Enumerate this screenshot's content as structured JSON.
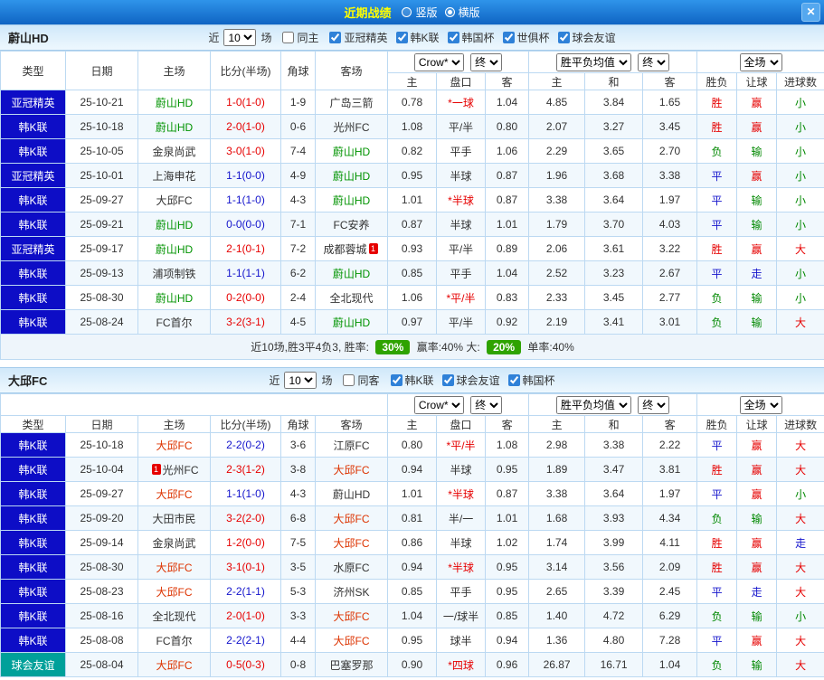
{
  "titlebar": {
    "title": "近期战绩",
    "radio_vertical": "竖版",
    "radio_horizontal": "横版",
    "selected": "横版",
    "close_icon": "✕"
  },
  "controls": {
    "recent_label": "近",
    "recent_value": "10",
    "matches_label": "场"
  },
  "odds_header": {
    "company_select": "Crow*",
    "final_label": "终",
    "europe_select": "胜平负均值",
    "fulltime_select": "全场",
    "ah_cols": [
      "主",
      "盘口",
      "客"
    ],
    "eu_cols": [
      "主",
      "和",
      "客"
    ],
    "result_cols": [
      "胜负",
      "让球",
      "进球数"
    ]
  },
  "table_header": [
    "类型",
    "日期",
    "主场",
    "比分(半场)",
    "角球",
    "客场"
  ],
  "colors": {
    "league_badge": "#0d0dc6",
    "friendly_badge": "#00a09a",
    "win": "#e60000",
    "draw": "#1414cc",
    "loss": "#008800",
    "team_home": "#009300",
    "team_away": "#dd3300",
    "rate_badge": "#2fa300"
  },
  "sections": [
    {
      "team": "蔚山HD",
      "same_venue_label": "同主",
      "same_venue_checked": false,
      "league_filters": [
        {
          "label": "亚冠精英",
          "checked": true
        },
        {
          "label": "韩K联",
          "checked": true
        },
        {
          "label": "韩国杯",
          "checked": true
        },
        {
          "label": "世俱杯",
          "checked": true
        },
        {
          "label": "球会友谊",
          "checked": true
        }
      ],
      "rows": [
        {
          "type": "亚冠精英",
          "tc": "league",
          "date": "25-10-21",
          "home": "蔚山HD",
          "home_c": "green",
          "home_card": "",
          "score": "1-0(1-0)",
          "score_c": "red",
          "corners": "1-9",
          "away": "广岛三箭",
          "away_c": "",
          "away_card": "",
          "ah": [
            "0.78",
            "*一球",
            "1.04"
          ],
          "ah_red": true,
          "eu": [
            "4.85",
            "3.84",
            "1.65"
          ],
          "res": [
            "胜",
            "赢",
            "小"
          ],
          "res_c": [
            "red",
            "red",
            "green"
          ]
        },
        {
          "type": "韩K联",
          "tc": "league",
          "date": "25-10-18",
          "home": "蔚山HD",
          "home_c": "green",
          "home_card": "",
          "score": "2-0(1-0)",
          "score_c": "red",
          "corners": "0-6",
          "away": "光州FC",
          "away_c": "",
          "away_card": "",
          "ah": [
            "1.08",
            "平/半",
            "0.80"
          ],
          "ah_red": false,
          "eu": [
            "2.07",
            "3.27",
            "3.45"
          ],
          "res": [
            "胜",
            "赢",
            "小"
          ],
          "res_c": [
            "red",
            "red",
            "green"
          ]
        },
        {
          "type": "韩K联",
          "tc": "league",
          "date": "25-10-05",
          "home": "金泉尚武",
          "home_c": "",
          "home_card": "",
          "score": "3-0(1-0)",
          "score_c": "red",
          "corners": "7-4",
          "away": "蔚山HD",
          "away_c": "green",
          "away_card": "",
          "ah": [
            "0.82",
            "平手",
            "1.06"
          ],
          "ah_red": false,
          "eu": [
            "2.29",
            "3.65",
            "2.70"
          ],
          "res": [
            "负",
            "输",
            "小"
          ],
          "res_c": [
            "green",
            "green",
            "green"
          ]
        },
        {
          "type": "亚冠精英",
          "tc": "league",
          "date": "25-10-01",
          "home": "上海申花",
          "home_c": "",
          "home_card": "",
          "score": "1-1(0-0)",
          "score_c": "blue",
          "corners": "4-9",
          "away": "蔚山HD",
          "away_c": "green",
          "away_card": "",
          "ah": [
            "0.95",
            "半球",
            "0.87"
          ],
          "ah_red": false,
          "eu": [
            "1.96",
            "3.68",
            "3.38"
          ],
          "res": [
            "平",
            "赢",
            "小"
          ],
          "res_c": [
            "blue",
            "red",
            "green"
          ]
        },
        {
          "type": "韩K联",
          "tc": "league",
          "date": "25-09-27",
          "home": "大邱FC",
          "home_c": "",
          "home_card": "",
          "score": "1-1(1-0)",
          "score_c": "blue",
          "corners": "4-3",
          "away": "蔚山HD",
          "away_c": "green",
          "away_card": "",
          "ah": [
            "1.01",
            "*半球",
            "0.87"
          ],
          "ah_red": true,
          "eu": [
            "3.38",
            "3.64",
            "1.97"
          ],
          "res": [
            "平",
            "输",
            "小"
          ],
          "res_c": [
            "blue",
            "green",
            "green"
          ]
        },
        {
          "type": "韩K联",
          "tc": "league",
          "date": "25-09-21",
          "home": "蔚山HD",
          "home_c": "green",
          "home_card": "",
          "score": "0-0(0-0)",
          "score_c": "blue",
          "corners": "7-1",
          "away": "FC安养",
          "away_c": "",
          "away_card": "",
          "ah": [
            "0.87",
            "半球",
            "1.01"
          ],
          "ah_red": false,
          "eu": [
            "1.79",
            "3.70",
            "4.03"
          ],
          "res": [
            "平",
            "输",
            "小"
          ],
          "res_c": [
            "blue",
            "green",
            "green"
          ]
        },
        {
          "type": "亚冠精英",
          "tc": "league",
          "date": "25-09-17",
          "home": "蔚山HD",
          "home_c": "green",
          "home_card": "",
          "score": "2-1(0-1)",
          "score_c": "red",
          "corners": "7-2",
          "away": "成都蓉城",
          "away_c": "",
          "away_card": "1",
          "ah": [
            "0.93",
            "平/半",
            "0.89"
          ],
          "ah_red": false,
          "eu": [
            "2.06",
            "3.61",
            "3.22"
          ],
          "res": [
            "胜",
            "赢",
            "大"
          ],
          "res_c": [
            "red",
            "red",
            "red"
          ]
        },
        {
          "type": "韩K联",
          "tc": "league",
          "date": "25-09-13",
          "home": "浦项制铁",
          "home_c": "",
          "home_card": "",
          "score": "1-1(1-1)",
          "score_c": "blue",
          "corners": "6-2",
          "away": "蔚山HD",
          "away_c": "green",
          "away_card": "",
          "ah": [
            "0.85",
            "平手",
            "1.04"
          ],
          "ah_red": false,
          "eu": [
            "2.52",
            "3.23",
            "2.67"
          ],
          "res": [
            "平",
            "走",
            "小"
          ],
          "res_c": [
            "blue",
            "blue",
            "green"
          ]
        },
        {
          "type": "韩K联",
          "tc": "league",
          "date": "25-08-30",
          "home": "蔚山HD",
          "home_c": "green",
          "home_card": "",
          "score": "0-2(0-0)",
          "score_c": "red",
          "corners": "2-4",
          "away": "全北现代",
          "away_c": "",
          "away_card": "",
          "ah": [
            "1.06",
            "*平/半",
            "0.83"
          ],
          "ah_red": true,
          "eu": [
            "2.33",
            "3.45",
            "2.77"
          ],
          "res": [
            "负",
            "输",
            "小"
          ],
          "res_c": [
            "green",
            "green",
            "green"
          ]
        },
        {
          "type": "韩K联",
          "tc": "league",
          "date": "25-08-24",
          "home": "FC首尔",
          "home_c": "",
          "home_card": "",
          "score": "3-2(3-1)",
          "score_c": "red",
          "corners": "4-5",
          "away": "蔚山HD",
          "away_c": "green",
          "away_card": "",
          "ah": [
            "0.97",
            "平/半",
            "0.92"
          ],
          "ah_red": false,
          "eu": [
            "2.19",
            "3.41",
            "3.01"
          ],
          "res": [
            "负",
            "输",
            "大"
          ],
          "res_c": [
            "green",
            "green",
            "red"
          ]
        }
      ],
      "summary": [
        {
          "t": "近10场,胜3平4负3, 胜率: "
        },
        {
          "b": "30%"
        },
        {
          "t": " 赢率:40% 大: "
        },
        {
          "b": "20%"
        },
        {
          "t": " 单率:40%"
        }
      ]
    },
    {
      "team": "大邱FC",
      "same_venue_label": "同客",
      "same_venue_checked": false,
      "league_filters": [
        {
          "label": "韩K联",
          "checked": true
        },
        {
          "label": "球会友谊",
          "checked": true
        },
        {
          "label": "韩国杯",
          "checked": true
        }
      ],
      "rows": [
        {
          "type": "韩K联",
          "tc": "league",
          "date": "25-10-18",
          "home": "大邱FC",
          "home_c": "red",
          "home_card": "",
          "score": "2-2(0-2)",
          "score_c": "blue",
          "corners": "3-6",
          "away": "江原FC",
          "away_c": "",
          "away_card": "",
          "ah": [
            "0.80",
            "*平/半",
            "1.08"
          ],
          "ah_red": true,
          "eu": [
            "2.98",
            "3.38",
            "2.22"
          ],
          "res": [
            "平",
            "赢",
            "大"
          ],
          "res_c": [
            "blue",
            "red",
            "red"
          ]
        },
        {
          "type": "韩K联",
          "tc": "league",
          "date": "25-10-04",
          "home": "光州FC",
          "home_c": "",
          "home_card": "1",
          "score": "2-3(1-2)",
          "score_c": "red",
          "corners": "3-8",
          "away": "大邱FC",
          "away_c": "red",
          "away_card": "",
          "ah": [
            "0.94",
            "半球",
            "0.95"
          ],
          "ah_red": false,
          "eu": [
            "1.89",
            "3.47",
            "3.81"
          ],
          "res": [
            "胜",
            "赢",
            "大"
          ],
          "res_c": [
            "red",
            "red",
            "red"
          ]
        },
        {
          "type": "韩K联",
          "tc": "league",
          "date": "25-09-27",
          "home": "大邱FC",
          "home_c": "red",
          "home_card": "",
          "score": "1-1(1-0)",
          "score_c": "blue",
          "corners": "4-3",
          "away": "蔚山HD",
          "away_c": "",
          "away_card": "",
          "ah": [
            "1.01",
            "*半球",
            "0.87"
          ],
          "ah_red": true,
          "eu": [
            "3.38",
            "3.64",
            "1.97"
          ],
          "res": [
            "平",
            "赢",
            "小"
          ],
          "res_c": [
            "blue",
            "red",
            "green"
          ]
        },
        {
          "type": "韩K联",
          "tc": "league",
          "date": "25-09-20",
          "home": "大田市民",
          "home_c": "",
          "home_card": "",
          "score": "3-2(2-0)",
          "score_c": "red",
          "corners": "6-8",
          "away": "大邱FC",
          "away_c": "red",
          "away_card": "",
          "ah": [
            "0.81",
            "半/一",
            "1.01"
          ],
          "ah_red": false,
          "eu": [
            "1.68",
            "3.93",
            "4.34"
          ],
          "res": [
            "负",
            "输",
            "大"
          ],
          "res_c": [
            "green",
            "green",
            "red"
          ]
        },
        {
          "type": "韩K联",
          "tc": "league",
          "date": "25-09-14",
          "home": "金泉尚武",
          "home_c": "",
          "home_card": "",
          "score": "1-2(0-0)",
          "score_c": "red",
          "corners": "7-5",
          "away": "大邱FC",
          "away_c": "red",
          "away_card": "",
          "ah": [
            "0.86",
            "半球",
            "1.02"
          ],
          "ah_red": false,
          "eu": [
            "1.74",
            "3.99",
            "4.11"
          ],
          "res": [
            "胜",
            "赢",
            "走"
          ],
          "res_c": [
            "red",
            "red",
            "blue"
          ]
        },
        {
          "type": "韩K联",
          "tc": "league",
          "date": "25-08-30",
          "home": "大邱FC",
          "home_c": "red",
          "home_card": "",
          "score": "3-1(0-1)",
          "score_c": "red",
          "corners": "3-5",
          "away": "水原FC",
          "away_c": "",
          "away_card": "",
          "ah": [
            "0.94",
            "*半球",
            "0.95"
          ],
          "ah_red": true,
          "eu": [
            "3.14",
            "3.56",
            "2.09"
          ],
          "res": [
            "胜",
            "赢",
            "大"
          ],
          "res_c": [
            "red",
            "red",
            "red"
          ]
        },
        {
          "type": "韩K联",
          "tc": "league",
          "date": "25-08-23",
          "home": "大邱FC",
          "home_c": "red",
          "home_card": "",
          "score": "2-2(1-1)",
          "score_c": "blue",
          "corners": "5-3",
          "away": "济州SK",
          "away_c": "",
          "away_card": "",
          "ah": [
            "0.85",
            "平手",
            "0.95"
          ],
          "ah_red": false,
          "eu": [
            "2.65",
            "3.39",
            "2.45"
          ],
          "res": [
            "平",
            "走",
            "大"
          ],
          "res_c": [
            "blue",
            "blue",
            "red"
          ]
        },
        {
          "type": "韩K联",
          "tc": "league",
          "date": "25-08-16",
          "home": "全北现代",
          "home_c": "",
          "home_card": "",
          "score": "2-0(1-0)",
          "score_c": "red",
          "corners": "3-3",
          "away": "大邱FC",
          "away_c": "red",
          "away_card": "",
          "ah": [
            "1.04",
            "一/球半",
            "0.85"
          ],
          "ah_red": false,
          "eu": [
            "1.40",
            "4.72",
            "6.29"
          ],
          "res": [
            "负",
            "输",
            "小"
          ],
          "res_c": [
            "green",
            "green",
            "green"
          ]
        },
        {
          "type": "韩K联",
          "tc": "league",
          "date": "25-08-08",
          "home": "FC首尔",
          "home_c": "",
          "home_card": "",
          "score": "2-2(2-1)",
          "score_c": "blue",
          "corners": "4-4",
          "away": "大邱FC",
          "away_c": "red",
          "away_card": "",
          "ah": [
            "0.95",
            "球半",
            "0.94"
          ],
          "ah_red": false,
          "eu": [
            "1.36",
            "4.80",
            "7.28"
          ],
          "res": [
            "平",
            "赢",
            "大"
          ],
          "res_c": [
            "blue",
            "red",
            "red"
          ]
        },
        {
          "type": "球会友谊",
          "tc": "friendly",
          "date": "25-08-04",
          "home": "大邱FC",
          "home_c": "red",
          "home_card": "",
          "score": "0-5(0-3)",
          "score_c": "red",
          "corners": "0-8",
          "away": "巴塞罗那",
          "away_c": "",
          "away_card": "",
          "ah": [
            "0.90",
            "*四球",
            "0.96"
          ],
          "ah_red": true,
          "eu": [
            "26.87",
            "16.71",
            "1.04"
          ],
          "res": [
            "负",
            "输",
            "大"
          ],
          "res_c": [
            "green",
            "green",
            "red"
          ]
        }
      ],
      "summary": null
    }
  ]
}
